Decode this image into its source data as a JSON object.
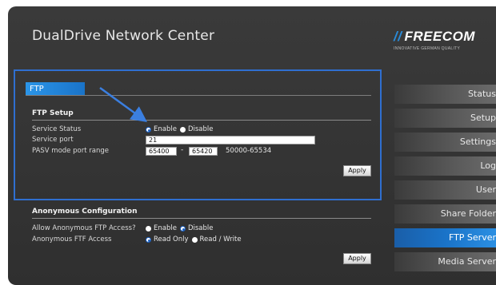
{
  "header": {
    "app_title": "DualDrive Network Center",
    "logo_text": "FREECOM",
    "logo_tagline": "INNOVATIVE GERMAN QUALITY"
  },
  "tab": {
    "label": "FTP"
  },
  "ftp_setup": {
    "title": "FTP Setup",
    "service_status_label": "Service Status",
    "enable_label": "Enable",
    "disable_label": "Disable",
    "service_status_value": "Enable",
    "service_port_label": "Service port",
    "service_port_value": "21",
    "pasv_label": "PASV mode port range",
    "pasv_from": "65400",
    "pasv_dash": "-",
    "pasv_to": "65420",
    "pasv_hint": "50000-65534",
    "apply_label": "Apply"
  },
  "anonymous": {
    "title": "Anonymous Configuration",
    "allow_label": "Allow Anonymous FTP Access?",
    "enable_label": "Enable",
    "disable_label": "Disable",
    "allow_value": "Disable",
    "access_label": "Anonymous FTF Access",
    "read_only_label": "Read Only",
    "read_write_label": "Read / Write",
    "access_value": "Read Only",
    "apply_label": "Apply"
  },
  "nav": {
    "items": [
      {
        "label": "Status"
      },
      {
        "label": "Setup"
      },
      {
        "label": "Settings"
      },
      {
        "label": "Log"
      },
      {
        "label": "User"
      },
      {
        "label": "Share Folder"
      },
      {
        "label": "FTP Server"
      },
      {
        "label": "Media Server"
      }
    ],
    "active": "FTP Server"
  },
  "colors": {
    "accent": "#1a73c8",
    "highlight_box": "#2f6fd0",
    "background": "#333333"
  }
}
